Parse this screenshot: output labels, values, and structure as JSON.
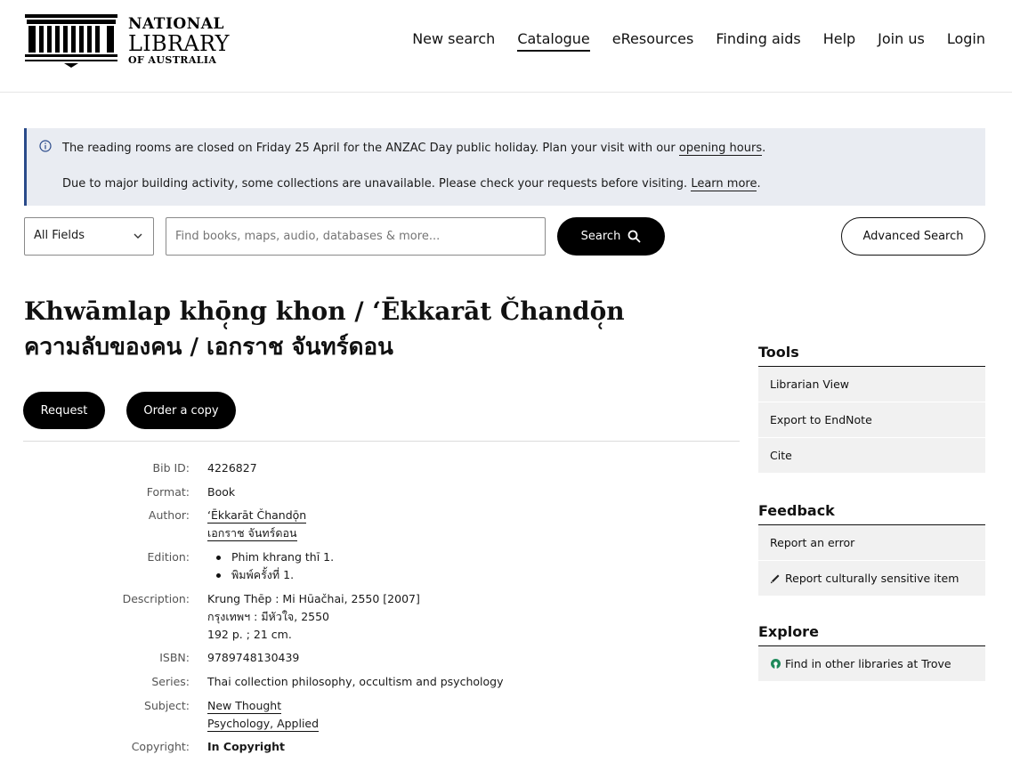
{
  "header": {
    "logo": {
      "line1": "NATIONAL",
      "line2": "LIBRARY",
      "line3": "OF AUSTRALIA"
    },
    "nav": [
      {
        "label": "New search",
        "active": false
      },
      {
        "label": "Catalogue",
        "active": true
      },
      {
        "label": "eResources",
        "active": false
      },
      {
        "label": "Finding aids",
        "active": false
      },
      {
        "label": "Help",
        "active": false
      },
      {
        "label": "Join us",
        "active": false
      },
      {
        "label": "Login",
        "active": false
      }
    ]
  },
  "alert": {
    "icon": "info-icon",
    "line1_text": "The reading rooms are closed on Friday 25 April for the ANZAC Day public holiday. Plan your visit with our ",
    "line1_link": "opening hours",
    "line1_end": ".",
    "line2_text": "Due to major building activity, some collections are unavailable. Please check your requests before visiting. ",
    "line2_link": "Learn more",
    "line2_end": "."
  },
  "search": {
    "field_select": "All Fields",
    "placeholder": "Find books, maps, audio, databases & more...",
    "search_label": "Search",
    "advanced_label": "Advanced Search"
  },
  "record": {
    "title_line1": "Khwāmlap khō̜ng khon / ʻĒkkarāt Čhandō̜n",
    "title_line2": "ความลับของคน / เอกราช จันทร์ดอน",
    "request_label": "Request",
    "order_label": "Order a copy",
    "fields": {
      "bib_id": {
        "label": "Bib ID:",
        "value": "4226827"
      },
      "format": {
        "label": "Format:",
        "value": "Book"
      },
      "author": {
        "label": "Author:",
        "values": [
          "ʻĒkkarāt Čhandō̜n",
          "เอกราช จันทร์ดอน"
        ]
      },
      "edition": {
        "label": "Edition:",
        "values": [
          "Phim khrang thī 1.",
          "พิมพ์ครั้งที่ 1."
        ]
      },
      "description": {
        "label": "Description:",
        "values": [
          "Krung Thēp : Mi Hūačhai, 2550 [2007]",
          "กรุงเทพฯ : มีหัวใจ, 2550",
          "192 p. ; 21 cm."
        ]
      },
      "isbn": {
        "label": "ISBN:",
        "value": "9789748130439"
      },
      "series": {
        "label": "Series:",
        "value": "Thai collection philosophy, occultism and psychology"
      },
      "subject": {
        "label": "Subject:",
        "values": [
          "New Thought",
          "Psychology, Applied"
        ]
      },
      "copyright": {
        "label": "Copyright:",
        "value": "In Copyright"
      }
    }
  },
  "sidebar": {
    "tools": {
      "heading": "Tools",
      "items": [
        "Librarian View",
        "Export to EndNote",
        "Cite"
      ]
    },
    "feedback": {
      "heading": "Feedback",
      "items": [
        "Report an error",
        "Report culturally sensitive item"
      ]
    },
    "explore": {
      "heading": "Explore",
      "items": [
        "Find in other libraries at Trove"
      ]
    }
  }
}
